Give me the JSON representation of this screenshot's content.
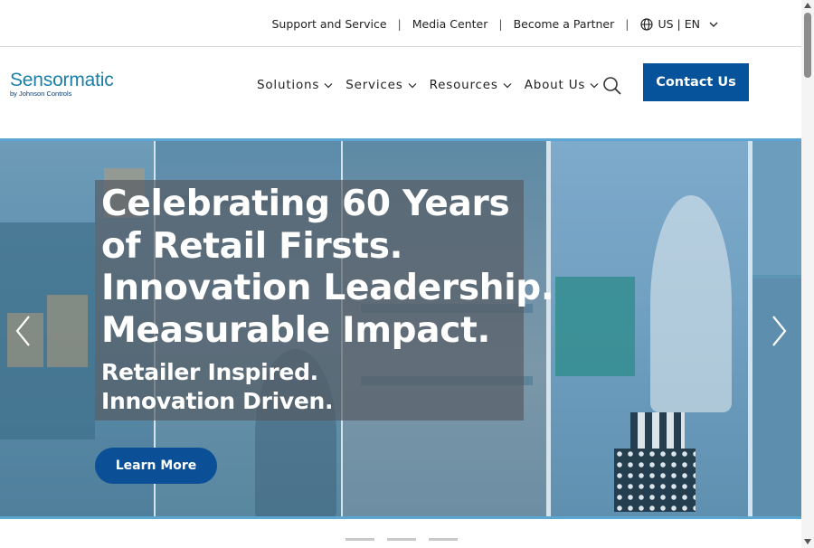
{
  "utility": {
    "links": [
      "Support and Service",
      "Media Center",
      "Become a Partner"
    ],
    "separator": "|",
    "language": "US | EN"
  },
  "header": {
    "logo": {
      "main": "Sensormatic",
      "sub": "by Johnson Controls"
    },
    "nav": [
      {
        "label": "Solutions",
        "icon": "chevron-down-icon"
      },
      {
        "label": "Services",
        "icon": "chevron-down-icon"
      },
      {
        "label": "Resources",
        "icon": "chevron-down-icon"
      },
      {
        "label": "About Us",
        "icon": "chevron-down-icon"
      }
    ],
    "search_icon": "search-icon",
    "contact_label": "Contact Us"
  },
  "hero": {
    "headline": [
      "Celebrating 60 Years",
      "of Retail Firsts.",
      "Innovation Leadership.",
      "Measurable Impact."
    ],
    "subhead": [
      "Retailer Inspired.",
      "Innovation Driven."
    ],
    "cta_label": "Learn More",
    "prev_icon": "chevron-left-icon",
    "next_icon": "chevron-right-icon"
  },
  "carousel": {
    "slide_count": 3
  },
  "colors": {
    "brand_blue": "#07539b",
    "logo_teal": "#1a7fa8",
    "hero_overlay": "#5c94b4",
    "cta_blue": "#0b4f96"
  }
}
